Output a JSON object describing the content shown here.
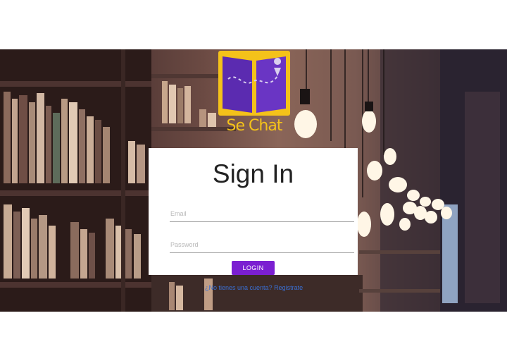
{
  "brand": {
    "logo_text": "Se Chat",
    "accent": "#f4c21a",
    "book_color": "#5b2bb0"
  },
  "login": {
    "title": "Sign In",
    "email_placeholder": "Email",
    "password_placeholder": "Password",
    "button_label": "LOGIN",
    "button_color": "#7b1fd1"
  },
  "signup": {
    "prompt": "¿No tienes una cuenta?",
    "link_label": "Registrate"
  }
}
